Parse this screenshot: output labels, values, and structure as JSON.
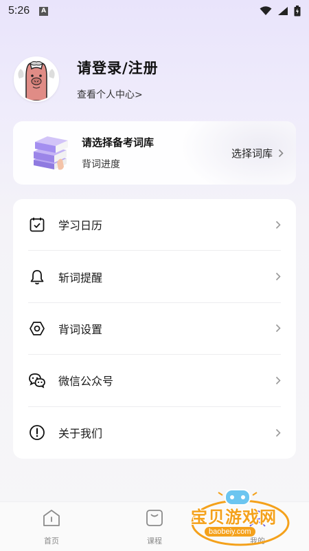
{
  "status_bar": {
    "time": "5:26",
    "notification_badge": "A"
  },
  "profile": {
    "title": "请登录/注册",
    "subtitle": "查看个人中心>"
  },
  "vocab_card": {
    "title": "请选择备考词库",
    "subtitle": "背词进度",
    "action": "选择词库"
  },
  "menu": [
    {
      "label": "学习日历",
      "icon": "calendar-icon"
    },
    {
      "label": "斩词提醒",
      "icon": "bell-icon"
    },
    {
      "label": "背词设置",
      "icon": "settings-hex-icon"
    },
    {
      "label": "微信公众号",
      "icon": "wechat-icon"
    },
    {
      "label": "关于我们",
      "icon": "info-icon"
    }
  ],
  "tabs": [
    {
      "label": "首页",
      "icon": "home-icon"
    },
    {
      "label": "课程",
      "icon": "course-icon"
    },
    {
      "label": "我的",
      "icon": "profile-icon"
    }
  ],
  "watermark": {
    "text": "宝贝游戏网",
    "url": "baobeiy.com"
  },
  "colors": {
    "accent": "#f4a11b",
    "background_top": "#e9e4fb",
    "text": "#1a1a1a"
  }
}
